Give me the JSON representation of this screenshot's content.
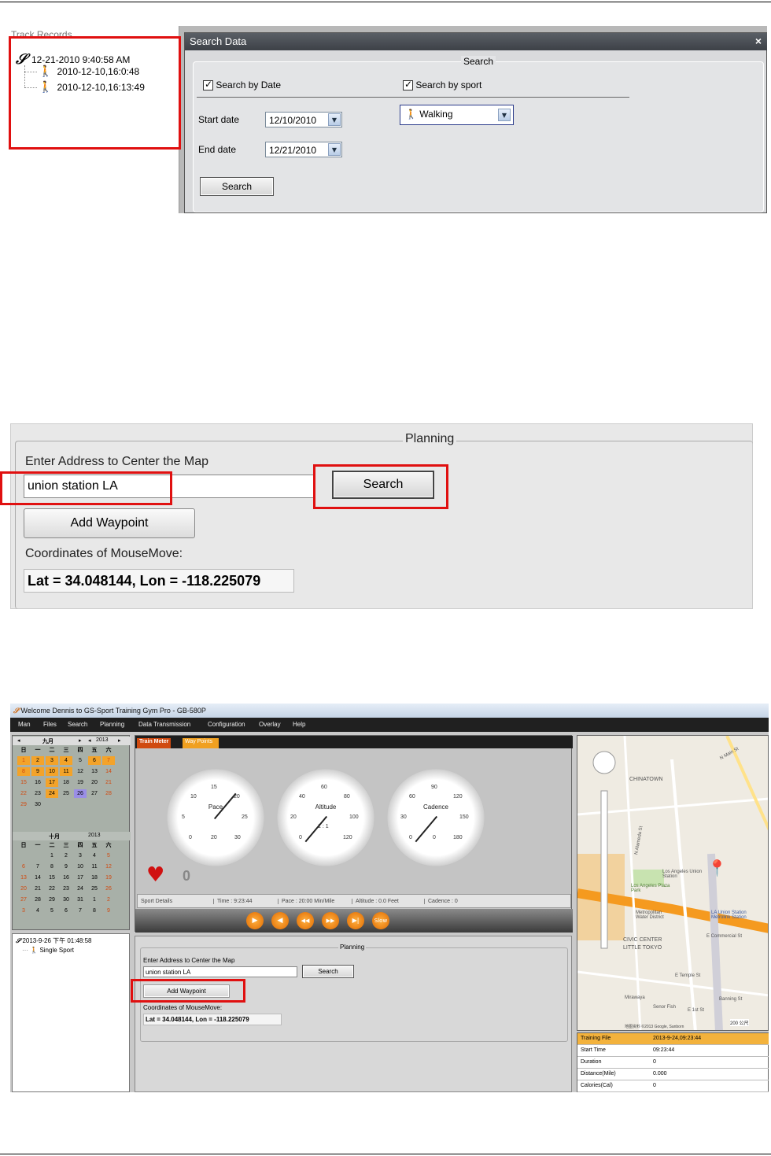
{
  "shot1": {
    "track_title": "Track Records",
    "track_items": [
      "12-21-2010 9:40:58 AM",
      "2010-12-10,16:0:48",
      "2010-12-10,16:13:49"
    ],
    "dialog_title": "Search Data",
    "close": "×",
    "group_title": "Search",
    "search_by_date": "Search by Date",
    "search_by_sport": "Search by sport",
    "start_label": "Start date",
    "start_value": "12/10/2010",
    "end_label": "End date",
    "end_value": "12/21/2010",
    "sport_value": "Walking",
    "search_button": "Search"
  },
  "shot2": {
    "group_title": "Planning",
    "address_label": "Enter Address to Center the Map",
    "address_value": "union station LA",
    "search_button": "Search",
    "add_waypoint": "Add Waypoint",
    "coord_label": "Coordinates of MouseMove:",
    "coord_value": "Lat = 34.048144, Lon = -118.225079"
  },
  "shot3": {
    "window_title": "Welcome Dennis to GS-Sport Training Gym Pro - GB-580P",
    "menu": [
      "Man",
      "Files",
      "Search",
      "Planning",
      "Data Transmission",
      "Configuration",
      "Overlay",
      "Help"
    ],
    "cal1": {
      "month": "九月",
      "year": "2013",
      "weekdays": [
        "日",
        "一",
        "二",
        "三",
        "四",
        "五",
        "六"
      ],
      "days": [
        "1",
        "2",
        "3",
        "4",
        "5",
        "6",
        "7",
        "8",
        "9",
        "10",
        "11",
        "12",
        "13",
        "14",
        "15",
        "16",
        "17",
        "18",
        "19",
        "20",
        "21",
        "22",
        "23",
        "24",
        "25",
        "26",
        "27",
        "28",
        "29",
        "30"
      ]
    },
    "cal2": {
      "month": "十月",
      "year": "2013",
      "weekdays": [
        "日",
        "一",
        "二",
        "三",
        "四",
        "五",
        "六"
      ],
      "days": [
        "1",
        "2",
        "3",
        "4",
        "5",
        "6",
        "7",
        "8",
        "9",
        "10",
        "11",
        "12",
        "13",
        "14",
        "15",
        "16",
        "17",
        "18",
        "19",
        "20",
        "21",
        "22",
        "23",
        "24",
        "25",
        "26",
        "27",
        "28",
        "29",
        "30",
        "31",
        "1",
        "2",
        "3",
        "4",
        "5",
        "6",
        "7",
        "8",
        "9"
      ]
    },
    "tree_root": "2013-9-26 下午 01:48:58",
    "tree_child": "Single Sport",
    "tabs": [
      "Train Meter",
      "Way Points"
    ],
    "gauges": [
      {
        "label": "Pace",
        "ticks": [
          "0",
          "5",
          "10",
          "15",
          "20",
          "25",
          "30"
        ],
        "value": "20"
      },
      {
        "label": "Altitude",
        "ticks": [
          "0",
          "20",
          "40",
          "60",
          "80",
          "100",
          "120"
        ],
        "sub": "1 : 1"
      },
      {
        "label": "Cadence",
        "ticks": [
          "0",
          "30",
          "60",
          "90",
          "120",
          "150",
          "180"
        ],
        "value": "0"
      }
    ],
    "heart_value": "0",
    "details": [
      "Sport Details",
      "Time : 9:23:44",
      "Pace : 20:00 Min/Mile",
      "Altitude : 0.0 Feet",
      "Cadence : 0"
    ],
    "controls": [
      "▶",
      "◀",
      "◀◀",
      "▶▶",
      "▶|",
      "Slow"
    ],
    "plan_title": "Planning",
    "plan_label": "Enter Address to Center the Map",
    "plan_input": "union station LA",
    "plan_search": "Search",
    "plan_add": "Add Waypoint",
    "plan_coord_label": "Coordinates of MouseMove:",
    "plan_coord_value": "Lat = 34.048144, Lon = -118.225079",
    "map_labels": [
      "CHINATOWN",
      "Los Angeles Union Station",
      "Los Angeles Plaza Park",
      "Metropolitan Water District",
      "LA Union Station Metrolink Station",
      "CIVIC CENTER",
      "LITTLE TOKYO",
      "E Commercial St",
      "E Temple St",
      "E 1st St",
      "N Alameda St",
      "N Main St",
      "Banning St",
      "Mirawaya",
      "Senor Fish",
      "200 公尺",
      "地图资料 ©2013 Google, Sanborn"
    ],
    "info": [
      [
        "Training File",
        "2013-9-24,09:23:44"
      ],
      [
        "Start Time",
        "09:23:44"
      ],
      [
        "Duration",
        "0"
      ],
      [
        "Distance(Mile)",
        "0.000"
      ],
      [
        "Calories(Cal)",
        "0"
      ]
    ]
  }
}
